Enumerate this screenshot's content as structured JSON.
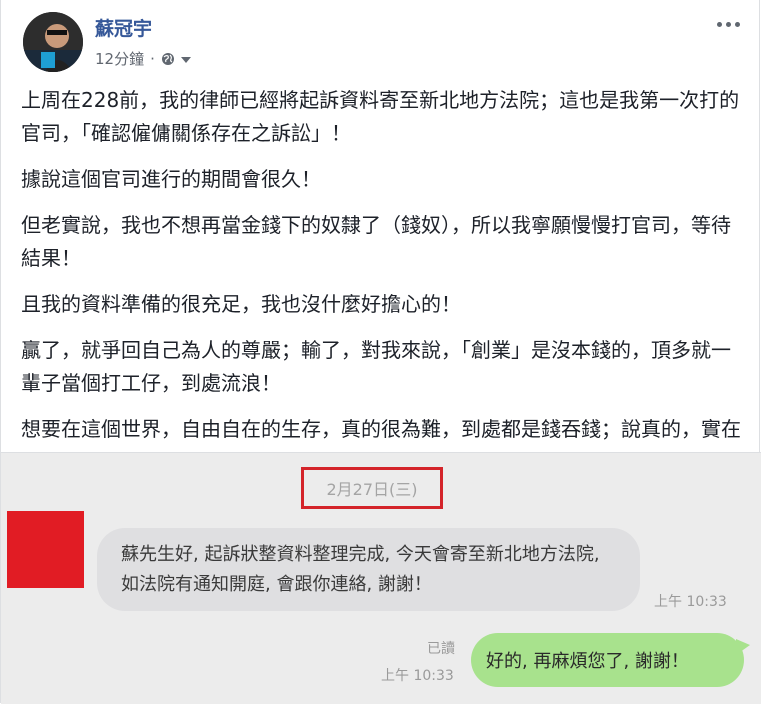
{
  "post": {
    "author": "蘇冠宇",
    "time": "12分鐘",
    "dot": "·",
    "paragraphs": [
      "上周在228前，我的律師已經將起訴資料寄至新北地方法院；這也是我第一次打的官司，「確認僱傭關係存在之訴訟」！",
      "據說這個官司進行的期間會很久！",
      "但老實說，我也不想再當金錢下的奴隸了（錢奴），所以我寧願慢慢打官司，等待結果！",
      "且我的資料準備的很充足，我也沒什麼好擔心的！",
      "贏了，就爭回自己為人的尊嚴；輸了，對我來說，「創業」是沒本錢的，頂多就一輩子當個打工仔，到處流浪！",
      "想要在這個世界，自由自在的生存，真的很為難，到處都是錢吞錢；說真的，實在很無奈！"
    ]
  },
  "chat": {
    "date": "2月27日(三)",
    "incoming_message": "蘇先生好, 起訴狀整資料整理完成, 今天會寄至新北地方法院, 如法院有通知開庭, 會跟你連絡, 謝謝！",
    "incoming_time": "上午 10:33",
    "read_label": "已讀",
    "outgoing_time": "上午 10:33",
    "outgoing_message": "好的, 再麻煩您了, 謝謝！",
    "highlight_color": "#d4242a"
  },
  "icons": [
    "globe-icon",
    "chevron-down-icon",
    "more-options-icon"
  ]
}
